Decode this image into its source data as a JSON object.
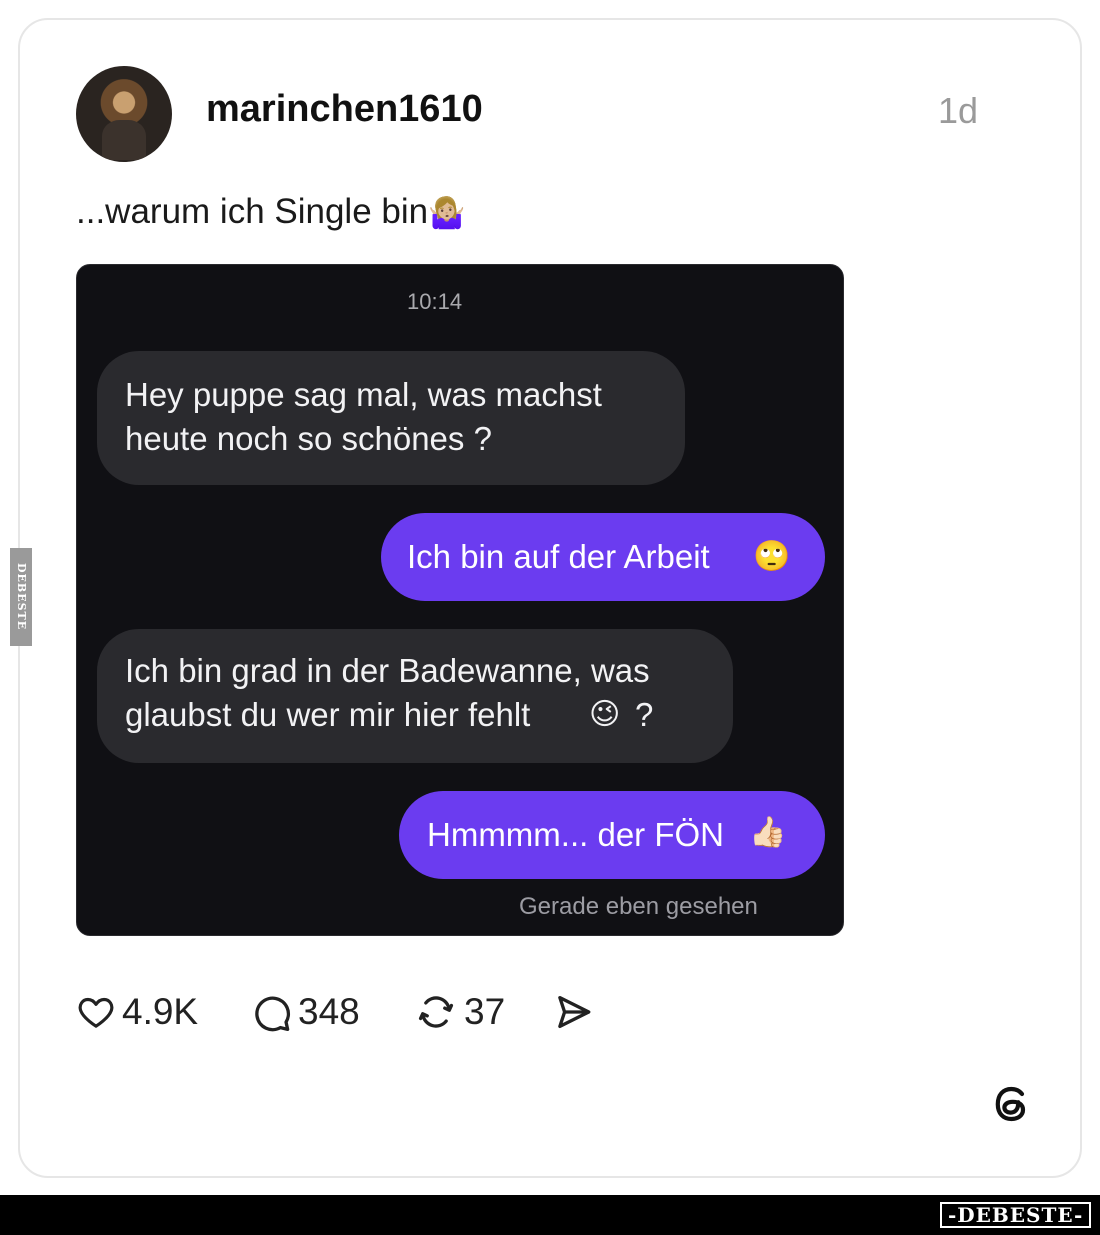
{
  "post": {
    "username": "marinchen1610",
    "time_ago": "1d",
    "caption": "...warum ich Single bin",
    "caption_emoji": "🤷🏼‍♀️"
  },
  "chat": {
    "time": "10:14",
    "messages": [
      {
        "from": "other",
        "line1": "Hey puppe sag mal, was machst",
        "line2": "heute noch so schönes ?"
      },
      {
        "from": "me",
        "line1": "Ich bin auf der Arbeit",
        "emoji": "🙄"
      },
      {
        "from": "other",
        "line1": "Ich bin grad in der Badewanne, was",
        "line2": "glaubst du wer mir hier fehlt",
        "emoji": "😉",
        "suffix": "?"
      },
      {
        "from": "me",
        "line1": "Hmmmm... der FÖN",
        "emoji": "👍🏻"
      }
    ],
    "seen": "Gerade eben gesehen"
  },
  "actions": {
    "likes": "4.9K",
    "comments": "348",
    "reposts": "37"
  },
  "icons": {
    "like": "heart-icon",
    "comment": "comment-bubble-icon",
    "repost": "repost-icon",
    "share": "send-icon",
    "brand": "threads-logo-icon"
  },
  "watermark": {
    "side": "DEBESTE",
    "footer": "-DEBESTE-"
  },
  "colors": {
    "outgoing_bubble": "#6b3cf0",
    "incoming_bubble": "#2a2a2e",
    "chat_background": "#101014"
  }
}
